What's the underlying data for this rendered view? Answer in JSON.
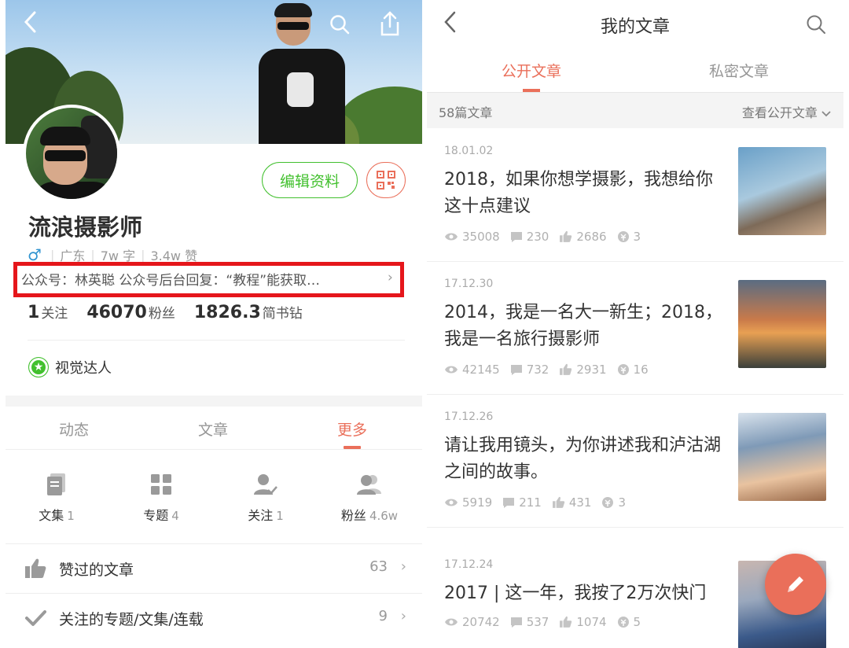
{
  "profile": {
    "username": "流浪摄影师",
    "location": "广东",
    "words": "7w 字",
    "likes": "3.4w 赞",
    "bio": "公众号：林英聪 公众号后台回复：“教程”能获取…",
    "edit_label": "编辑资料",
    "stats": [
      {
        "num": "1",
        "label": "关注"
      },
      {
        "num": "46070",
        "label": "粉丝"
      },
      {
        "num": "1826.3",
        "label": "简书钻"
      }
    ],
    "badge": "视觉达人"
  },
  "left_tabs": [
    {
      "label": "动态"
    },
    {
      "label": "文章"
    },
    {
      "label": "更多"
    }
  ],
  "grid": [
    {
      "label": "文集",
      "count": "1",
      "icon": "book-icon"
    },
    {
      "label": "专题",
      "count": "4",
      "icon": "grid-icon"
    },
    {
      "label": "关注",
      "count": "1",
      "icon": "user-check-icon"
    },
    {
      "label": "粉丝",
      "count": "4.6w",
      "icon": "users-icon"
    }
  ],
  "rows": [
    {
      "label": "赞过的文章",
      "count": "63",
      "icon": "thumbs-up-icon"
    },
    {
      "label": "关注的专题/文集/连载",
      "count": "9",
      "icon": "check-icon"
    }
  ],
  "right": {
    "title": "我的文章",
    "tabs": [
      {
        "label": "公开文章"
      },
      {
        "label": "私密文章"
      }
    ],
    "count": "58篇文章",
    "view": "查看公开文章",
    "articles": [
      {
        "date": "18.01.02",
        "title": "2018，如果你想学摄影，我想给你这十点建议",
        "views": "35008",
        "comments": "230",
        "likes": "2686",
        "rewards": "3"
      },
      {
        "date": "17.12.30",
        "title": "2014，我是一名大一新生；2018，我是一名旅行摄影师",
        "views": "42145",
        "comments": "732",
        "likes": "2931",
        "rewards": "16"
      },
      {
        "date": "17.12.26",
        "title": "请让我用镜头，为你讲述我和泸沽湖之间的故事。",
        "views": "5919",
        "comments": "211",
        "likes": "431",
        "rewards": "3"
      },
      {
        "date": "17.12.24",
        "title": "2017 | 这一年，我按了2万次快门",
        "views": "20742",
        "comments": "537",
        "likes": "1074",
        "rewards": "5"
      }
    ]
  },
  "colors": {
    "accent": "#ea6f5a",
    "green": "#42c02e",
    "highlight": "#e5161b"
  }
}
